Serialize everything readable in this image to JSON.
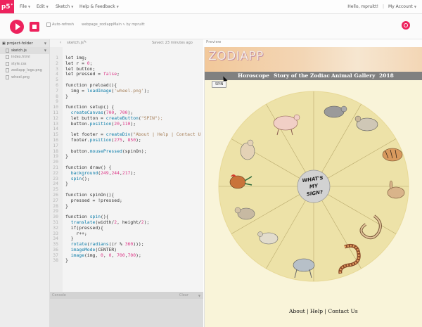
{
  "nav": {
    "logo": "p5",
    "logo_sup": "*",
    "menus": [
      "File",
      "Edit",
      "Sketch",
      "Help & Feedback"
    ],
    "greeting": "Hello, mpruitt!",
    "account": "My Account"
  },
  "toolbar": {
    "auto_refresh": "Auto-refresh",
    "project_name": "webpage_zodiappMain",
    "author": "by mpruitt"
  },
  "sidebar": {
    "header": "project-folder",
    "files": [
      {
        "name": "sketch.js",
        "active": true
      },
      {
        "name": "index.html",
        "active": false
      },
      {
        "name": "style.css",
        "active": false
      },
      {
        "name": "zodiapp_logo.png",
        "active": false
      },
      {
        "name": "wheel.png",
        "active": false
      }
    ]
  },
  "editor": {
    "tab": "sketch.js",
    "saved": "Saved: 23 minutes ago",
    "lines": [
      "let img;",
      "let r = 0;",
      "let button;",
      "let pressed = false;",
      "",
      "function preload(){",
      "  img = loadImage('wheel.png');",
      "}",
      "",
      "function setup() {",
      "  createCanvas(700, 700);",
      "  let button = createButton(\"SPIN\");",
      "  button.position(20,110);",
      "",
      "  let footer = createDiv(\"About | Help | Contact U",
      "  footer.position(275, 850);",
      "",
      "  button.mousePressed(spinOn);",
      "}",
      "",
      "function draw() {",
      "  background(249,244,217);",
      "  spin();",
      "}",
      "",
      "function spinOn(){",
      "  pressed = !pressed;",
      "}",
      "",
      "function spin(){",
      "  translate(width/2, height/2);",
      "  if(pressed){",
      "    r++;",
      "  }",
      "  rotate(radians((r % 360)));",
      "  imageMode(CENTER)",
      "  image(img, 0, 0, 700,700);",
      "}"
    ]
  },
  "console": {
    "label": "Console",
    "clear": "Clear"
  },
  "preview": {
    "label": "Preview",
    "logo_text": "ZODIAPP",
    "nav_items": [
      "Horoscope",
      "Story of the Zodiac",
      "Animal Gallery",
      "2018"
    ],
    "spin_label": "SPIN",
    "wheel_center": [
      "WHAT'S",
      "MY",
      "SIGN?"
    ],
    "footer": "About | Help | Contact Us"
  },
  "colors": {
    "accent": "#ed225d",
    "preview_bg": "#f9f4d9",
    "wheel_face": "#ede2a8",
    "navbar": "#808080"
  }
}
